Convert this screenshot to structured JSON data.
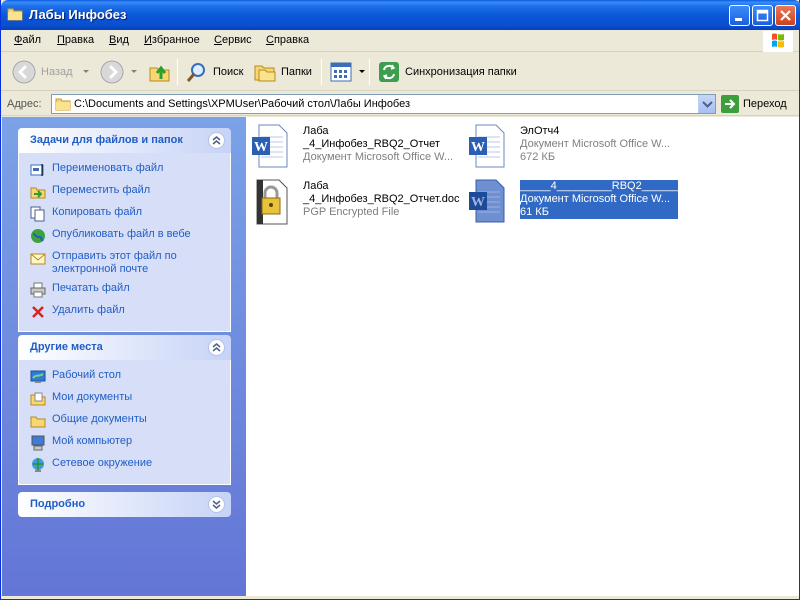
{
  "window": {
    "title": "Лабы Инфобез"
  },
  "menu": [
    {
      "label_u": "Ф",
      "label_rest": "айл"
    },
    {
      "label_u": "П",
      "label_rest": "равка"
    },
    {
      "label_u": "В",
      "label_rest": "ид"
    },
    {
      "label_u": "И",
      "label_rest": "збранное"
    },
    {
      "label_u": "С",
      "label_rest": "ервис"
    },
    {
      "label_u": "С",
      "label_rest": "правка"
    }
  ],
  "toolbar": {
    "back": "Назад",
    "search": "Поиск",
    "folders": "Папки",
    "sync": "Синхронизация папки"
  },
  "address": {
    "label": "Адрес:",
    "value": "C:\\Documents and Settings\\XPMUser\\Рабочий стол\\Лабы Инфобез",
    "go": "Переход"
  },
  "tasks_panel": {
    "title": "Задачи для файлов и папок",
    "items": [
      {
        "label": "Переименовать файл",
        "icon": "rename-icon"
      },
      {
        "label": "Переместить файл",
        "icon": "move-icon"
      },
      {
        "label": "Копировать файл",
        "icon": "copy-icon"
      },
      {
        "label": "Опубликовать файл в вебе",
        "icon": "web-publish-icon"
      },
      {
        "label": "Отправить этот файл по электронной почте",
        "icon": "email-icon"
      },
      {
        "label": "Печатать файл",
        "icon": "printer-icon"
      },
      {
        "label": "Удалить файл",
        "icon": "delete-icon"
      }
    ]
  },
  "places_panel": {
    "title": "Другие места",
    "items": [
      {
        "label": "Рабочий стол",
        "icon": "desktop-icon"
      },
      {
        "label": "Мои документы",
        "icon": "my-documents-icon"
      },
      {
        "label": "Общие документы",
        "icon": "shared-documents-icon"
      },
      {
        "label": "Мой компьютер",
        "icon": "my-computer-icon"
      },
      {
        "label": "Сетевое окружение",
        "icon": "network-icon"
      }
    ]
  },
  "details_panel": {
    "title": "Подробно"
  },
  "files": [
    {
      "name1": "Лаба",
      "name2": "_4_Инфобез_RBQ2_Отчет",
      "type": "Документ Microsoft Office W...",
      "size": "",
      "icon": "word-document-icon",
      "selected": false
    },
    {
      "name1": "ЭлОтч4",
      "name2": "",
      "type": "Документ Microsoft Office W...",
      "size": "672 КБ",
      "icon": "word-document-icon",
      "selected": false
    },
    {
      "name1": "Лаба",
      "name2": "_4_Инфобез_RBQ2_Отчет.doc",
      "type": "PGP Encrypted File",
      "size": "",
      "icon": "pgp-encrypted-icon",
      "selected": false
    },
    {
      "name1": "_____4_________RBQ2______",
      "name2": "",
      "type": "Документ Microsoft Office W...",
      "size": "61 КБ",
      "icon": "word-document-icon",
      "selected": true
    }
  ],
  "colors": {
    "titlebar": "#0A4FD0",
    "task_link": "#215DC6",
    "pane_top": "#7BA2E7",
    "pane_bottom": "#6375D6",
    "selection": "#316AC5"
  }
}
